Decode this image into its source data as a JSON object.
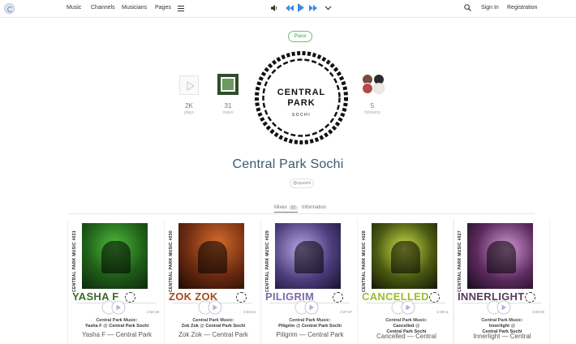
{
  "nav": {
    "music": "Music",
    "channels": "Channels",
    "musicians": "Musicians",
    "pages": "Pages",
    "sign_in": "Sign In",
    "registration": "Registration"
  },
  "colors": {
    "accent": "#3a8de0",
    "place_tag": "#4aa24e",
    "title": "#3a5a70"
  },
  "profile": {
    "tag": "Place",
    "logo_line1": "CENTRAL",
    "logo_line2": "PARK",
    "logo_line3": "SOCHI",
    "plays_count": "2K",
    "plays_label": "plays",
    "mixes_count": "31",
    "mixes_label": "mixes",
    "followers_count": "5",
    "followers_label": "followers",
    "title": "Central Park Sochi",
    "handle": "@cpsochi"
  },
  "tabs": [
    {
      "label": "Mixes",
      "badge": "31"
    },
    {
      "label": "Information"
    }
  ],
  "cards": [
    {
      "vertical": "CENTRAL PARK MUSIC #031",
      "artist": "YASHA F",
      "artist_color": "#3d6b2d",
      "duration": "2:52:19",
      "line1": "Central Park Music:",
      "line2a": "Yasha F",
      "line2b": " @ ",
      "line2c": "Central Park Sochi",
      "line3": "",
      "title": "Yasha F — Central Park"
    },
    {
      "vertical": "CENTRAL PARK MUSIC #030",
      "artist": "ZOK ZOK",
      "artist_color": "#a8481c",
      "duration": "3:20:44",
      "line1": "Central Park Music:",
      "line2a": "Zok Zok",
      "line2b": " @ ",
      "line2c": "Central Park Sochi",
      "line3": "",
      "title": "Zok Zok — Central Park"
    },
    {
      "vertical": "CENTRAL PARK MUSIC #029",
      "artist": "PILIGRIM",
      "artist_color": "#7b6ba8",
      "duration": "2:27:37",
      "line1": "Central Park Music:",
      "line2a": "Piligrim",
      "line2b": " @ ",
      "line2c": "Central Park Sochi",
      "line3": "",
      "title": "Piligrim — Central Park"
    },
    {
      "vertical": "CENTRAL PARK MUSIC #028",
      "artist": "CANCELLED",
      "artist_color": "#9bbd2a",
      "duration": "1:09:11",
      "line1": "Central Park Music:",
      "line2a": "Cancelled",
      "line2b": " @",
      "line2c": "",
      "line3": "Central Park Sochi",
      "title": "Cancelled — Central"
    },
    {
      "vertical": "CENTRAL PARK MUSIC #027",
      "artist": "INNERLIGHT",
      "artist_color": "#5a3a5e",
      "duration": "2:09:40",
      "line1": "Central Park Music:",
      "line2a": "Innerlight",
      "line2b": " @",
      "line2c": "",
      "line3": "Central Park Sochi",
      "title": "Innerlight — Central"
    }
  ]
}
